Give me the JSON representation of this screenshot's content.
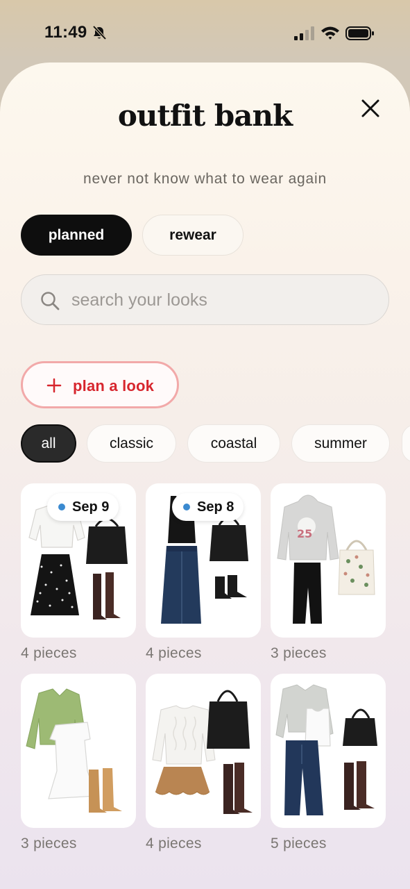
{
  "status": {
    "time": "11:49",
    "icons": [
      "bell-slash-icon",
      "signal-icon",
      "wifi-icon",
      "battery-icon"
    ]
  },
  "header": {
    "title": "outfit bank",
    "subtitle": "never not know what to wear again",
    "close_icon": "close-icon"
  },
  "segments": [
    {
      "label": "planned",
      "selected": true
    },
    {
      "label": "rewear",
      "selected": false
    }
  ],
  "search": {
    "placeholder": "search your looks",
    "value": ""
  },
  "plan_button": {
    "label": "plan a look",
    "icon": "plus-icon",
    "color": "#d7262e"
  },
  "filters": [
    {
      "label": "all",
      "selected": true
    },
    {
      "label": "classic",
      "selected": false
    },
    {
      "label": "coastal",
      "selected": false
    },
    {
      "label": "summer",
      "selected": false
    }
  ],
  "outfits": [
    {
      "pieces_label": "4 pieces",
      "date": "Sep 9"
    },
    {
      "pieces_label": "4 pieces",
      "date": "Sep 8"
    },
    {
      "pieces_label": "3 pieces",
      "date": null
    },
    {
      "pieces_label": "3 pieces",
      "date": null
    },
    {
      "pieces_label": "4 pieces",
      "date": null
    },
    {
      "pieces_label": "5 pieces",
      "date": null
    }
  ],
  "colors": {
    "date_dot": "#3b8ad0",
    "selected_pill": "#0e0e0e",
    "accent": "#d7262e"
  }
}
